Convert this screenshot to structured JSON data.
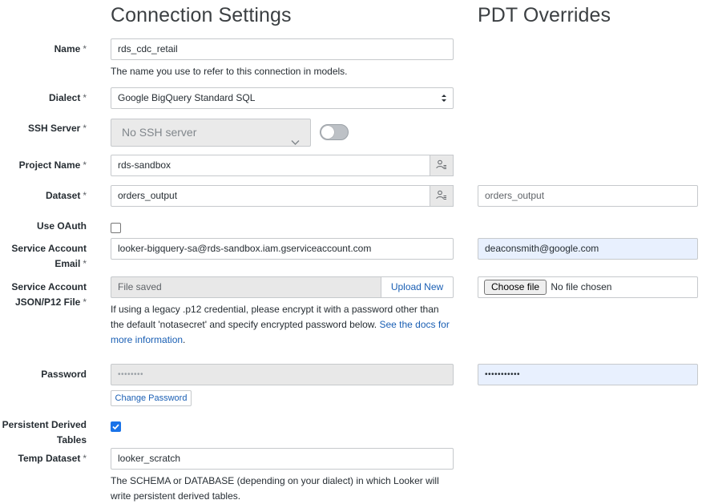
{
  "headings": {
    "connection_settings": "Connection Settings",
    "pdt_overrides": "PDT Overrides"
  },
  "required_marker": "*",
  "fields": {
    "name": {
      "label": "Name",
      "value": "rds_cdc_retail",
      "hint": "The name you use to refer to this connection in models."
    },
    "dialect": {
      "label": "Dialect",
      "value": "Google BigQuery Standard SQL"
    },
    "ssh_server": {
      "label": "SSH Server",
      "value": "No SSH server"
    },
    "project_name": {
      "label": "Project Name",
      "value": "rds-sandbox"
    },
    "dataset": {
      "label": "Dataset",
      "value": "orders_output",
      "pdt_value": "orders_output"
    },
    "use_oauth": {
      "label": "Use OAuth",
      "checked": false
    },
    "service_account_email": {
      "label_line1": "Service Account",
      "label_line2": "Email",
      "value": "looker-bigquery-sa@rds-sandbox.iam.gserviceaccount.com",
      "pdt_value": "deaconsmith@google.com"
    },
    "service_account_file": {
      "label_line1": "Service Account",
      "label_line2": "JSON/P12 File",
      "value": "File saved",
      "upload_label": "Upload New",
      "hint_line1": "If using a legacy .p12 credential, please encrypt it with a password other than",
      "hint_line2_prefix": "the default 'notasecret' and specify encrypted password below.",
      "hint_link_line2": "See the docs for",
      "hint_link_line3": "more information",
      "hint_suffix": ".",
      "pdt_choose_label": "Choose file",
      "pdt_no_file": "No file chosen"
    },
    "password": {
      "label": "Password",
      "value": "••••••••",
      "pdt_value": "•••••••••••",
      "change_label": "Change Password"
    },
    "pdt": {
      "label_line1": "Persistent Derived",
      "label_line2": "Tables",
      "checked": true
    },
    "temp_dataset": {
      "label": "Temp Dataset",
      "value": "looker_scratch",
      "hint_line1": "The SCHEMA or DATABASE (depending on your dialect) in which Looker will",
      "hint_line2": "write persistent derived tables."
    }
  },
  "colors": {
    "accent_blue": "#1a73e8",
    "link_blue": "#1a5fb4",
    "autofill_blue": "#e8f0fe"
  }
}
